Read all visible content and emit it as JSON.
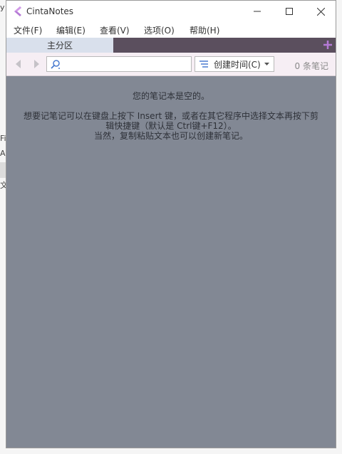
{
  "app": {
    "title": "CintaNotes"
  },
  "window_controls": {
    "minimize": "minimize",
    "maximize": "maximize",
    "close": "close"
  },
  "menu": [
    "文件(F)",
    "编辑(E)",
    "查看(V)",
    "选项(O)",
    "帮助(H)"
  ],
  "tabs": [
    {
      "label": "主分区",
      "active": true
    }
  ],
  "toolbar": {
    "search_value": "",
    "sort_label": "创建时间(C)",
    "note_count": "0 条笔记"
  },
  "empty_state": {
    "line1": "您的笔记本是空的。",
    "line2": "想要记笔记可以在键盘上按下 Insert 键，或者在其它程序中选择文本再按下剪",
    "line3": "辑快捷键（默认是 Ctrl键+F12）。",
    "line4": "当然，复制粘贴文本也可以创建新笔记。"
  },
  "background_fragments": {
    "top": "y",
    "mid1": "Fi",
    "mid2": "A",
    "mid3": "文"
  },
  "colors": {
    "tabbar": "#5b4f5e",
    "active_tab": "#d9e0ec",
    "toolbar": "#f6eef4",
    "content": "#828894",
    "logo": "#b57ad6"
  }
}
